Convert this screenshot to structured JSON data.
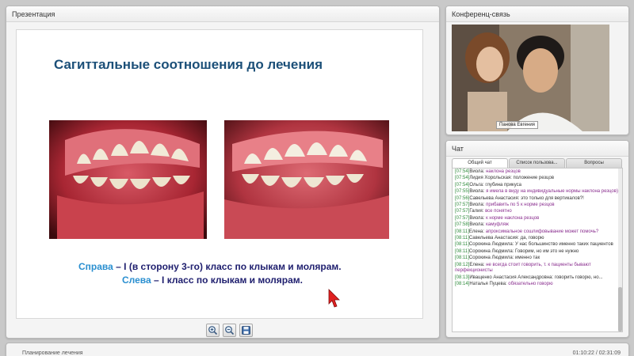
{
  "presentation": {
    "panel_title": "Презентация",
    "slide_title": "Сагиттальные соотношения до лечения",
    "caption_line1_highlight": "Справа",
    "caption_line1_rest": " – I (в сторону 3-го) класс по клыкам и молярам.",
    "caption_line2_highlight": "Слева",
    "caption_line2_rest": " – I класс по клыкам и молярам.",
    "toolbar": {
      "zoom_in_icon": "zoom-in-icon",
      "zoom_out_icon": "zoom-out-icon",
      "save_icon": "save-icon"
    }
  },
  "conference": {
    "panel_title": "Конференц-связь",
    "participant_name": "Панова Евгения"
  },
  "chat": {
    "panel_title": "Чат",
    "tabs": [
      "Общий чат",
      "Список пользова...",
      "Вопросы"
    ],
    "active_tab": 0,
    "messages": [
      {
        "time": "[07:54]",
        "author": "Виола:",
        "text": "наклона резцов",
        "purple": true
      },
      {
        "time": "[07:54]",
        "author": "Лидия Хорольская:",
        "text": "положение резцов",
        "purple": false
      },
      {
        "time": "[07:54]",
        "author": "Ольга:",
        "text": "глубина прикуса",
        "purple": false
      },
      {
        "time": "[07:55]",
        "author": "Виола:",
        "text": "я имела в виду на индивидуальные нормы наклона резцов))",
        "purple": true
      },
      {
        "time": "[07:56]",
        "author": "Савельева Анастасия:",
        "text": "это только для вертикалов?!",
        "purple": false
      },
      {
        "time": "[07:57]",
        "author": "Виола:",
        "text": "прибавить по 5 к норме резцов",
        "purple": true
      },
      {
        "time": "[07:57]",
        "author": "Галия:",
        "text": "все понятно",
        "purple": true
      },
      {
        "time": "[07:57]",
        "author": "Виола:",
        "text": "к норме наклона резцов",
        "purple": true
      },
      {
        "time": "[07:58]",
        "author": "Виола:",
        "text": "камуфляж",
        "purple": true
      },
      {
        "time": "[08:11]",
        "author": "Елена:",
        "text": "апроксимальное сошлифовывание может помочь?",
        "purple": true
      },
      {
        "time": "[08:11]",
        "author": "Савельева Анастасия:",
        "text": "да, говорю",
        "purple": false
      },
      {
        "time": "[08:11]",
        "author": "Сорокина Людмила:",
        "text": "У нас большинство именно таких пациентов",
        "purple": false
      },
      {
        "time": "[08:11]",
        "author": "Сорокина Людмила:",
        "text": "Говорим, но им это не нужно",
        "purple": false
      },
      {
        "time": "[08:11]",
        "author": "Сорокина Людмила:",
        "text": "именно так",
        "purple": false
      },
      {
        "time": "[08:12]",
        "author": "Елена:",
        "text": "не всегда стоит говорить, т. к пациенты бывают перфекционисты",
        "purple": true
      },
      {
        "time": "[08:13]",
        "author": "Иващенко Анастасия Александровна:",
        "text": "говорить говорю, но...",
        "purple": false
      },
      {
        "time": "[08:14]",
        "author": "Наталья Пуцева:",
        "text": "обязательно говорю",
        "purple": true
      }
    ]
  },
  "status": {
    "title": "Планирование лечения",
    "time": "01:10:22 / 02:31:09"
  },
  "colors": {
    "slide_title": "#1b4f78",
    "caption_highlight": "#2a8fd0",
    "caption_text": "#1e1e6e",
    "chat_time": "#2d8a3a",
    "chat_purple": "#8a2f8f"
  }
}
